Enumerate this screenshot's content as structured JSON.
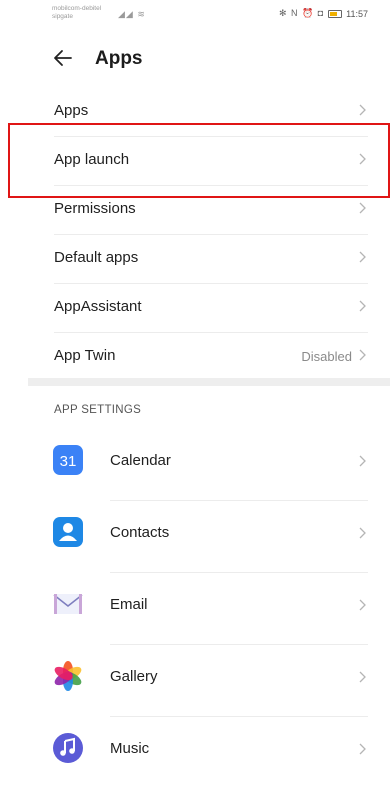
{
  "status_bar": {
    "carrier_line1": "mobilcom-debitel",
    "carrier_line2": "sipgate",
    "signal_glyphs": "◢◢ ≋",
    "status_icons": "✻ N ⏰ ◘",
    "time": "11:57"
  },
  "header": {
    "title": "Apps",
    "back_icon": "arrow-left-icon"
  },
  "menu": [
    {
      "label": "Apps",
      "value": ""
    },
    {
      "label": "App launch",
      "value": ""
    },
    {
      "label": "Permissions",
      "value": ""
    },
    {
      "label": "Default apps",
      "value": ""
    },
    {
      "label": "AppAssistant",
      "value": ""
    },
    {
      "label": "App Twin",
      "value": "Disabled"
    }
  ],
  "section": {
    "title": "APP SETTINGS"
  },
  "apps": [
    {
      "name": "Calendar",
      "icon": "calendar-icon",
      "icon_text": "31",
      "color": "#3b82f6"
    },
    {
      "name": "Contacts",
      "icon": "contacts-icon",
      "color": "#1e88e5"
    },
    {
      "name": "Email",
      "icon": "email-icon",
      "color": "#7e7ebf"
    },
    {
      "name": "Gallery",
      "icon": "gallery-icon",
      "color": "#f4511e"
    },
    {
      "name": "Music",
      "icon": "music-icon",
      "color": "#5b5bd6"
    }
  ],
  "colors": {
    "highlight": "#e01515",
    "divider": "#ececec",
    "secondary_text": "#8a8a8a"
  }
}
